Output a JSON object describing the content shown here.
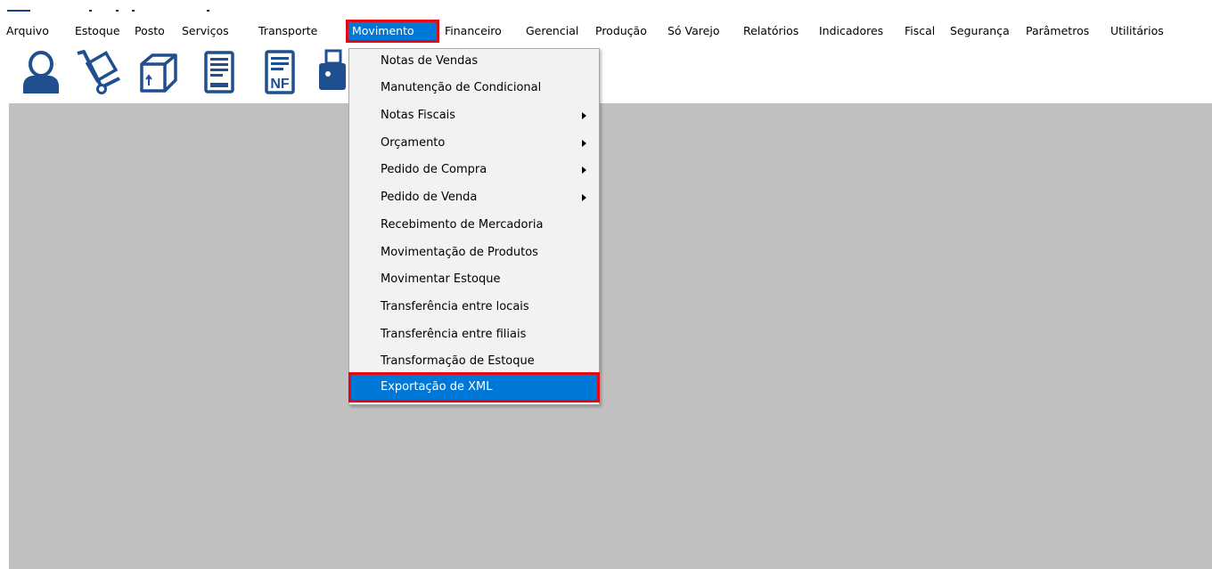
{
  "menubar": {
    "items": [
      {
        "label": "Arquivo"
      },
      {
        "label": "Estoque"
      },
      {
        "label": "Posto"
      },
      {
        "label": "Serviços"
      },
      {
        "label": "Transporte"
      },
      {
        "label": "Movimento"
      },
      {
        "label": "Financeiro"
      },
      {
        "label": "Gerencial"
      },
      {
        "label": "Produção"
      },
      {
        "label": "Só Varejo"
      },
      {
        "label": "Relatórios"
      },
      {
        "label": "Indicadores"
      },
      {
        "label": "Fiscal"
      },
      {
        "label": "Segurança"
      },
      {
        "label": "Parâmetros"
      },
      {
        "label": "Utilitários"
      }
    ],
    "active": "Movimento"
  },
  "toolbar": {
    "icons": [
      "user-icon",
      "hand-truck-icon",
      "box-icon",
      "document-icon",
      "nf-document-icon",
      "printer-icon"
    ],
    "nf_text": "NF"
  },
  "movimento_menu": {
    "items": [
      {
        "label": "Notas de Vendas"
      },
      {
        "label": "Manutenção de Condicional"
      },
      {
        "label": "Notas Fiscais",
        "submenu": true
      },
      {
        "label": "Orçamento",
        "submenu": true
      },
      {
        "label": "Pedido de Compra",
        "submenu": true
      },
      {
        "label": "Pedido de Venda",
        "submenu": true
      },
      {
        "label": "Recebimento de Mercadoria"
      },
      {
        "label": "Movimentação de Produtos"
      },
      {
        "label": "Movimentar Estoque"
      },
      {
        "label": "Transferência entre locais"
      },
      {
        "label": "Transferência entre filiais"
      },
      {
        "label": "Transformação de Estoque"
      },
      {
        "label": "Exportação de XML"
      }
    ],
    "highlighted": "Exportação de XML"
  },
  "colors": {
    "accent": "#0078d7",
    "highlight_outline": "#e30613",
    "workspace": "#c0c0c0",
    "icon_blue": "#1f4f8f"
  }
}
